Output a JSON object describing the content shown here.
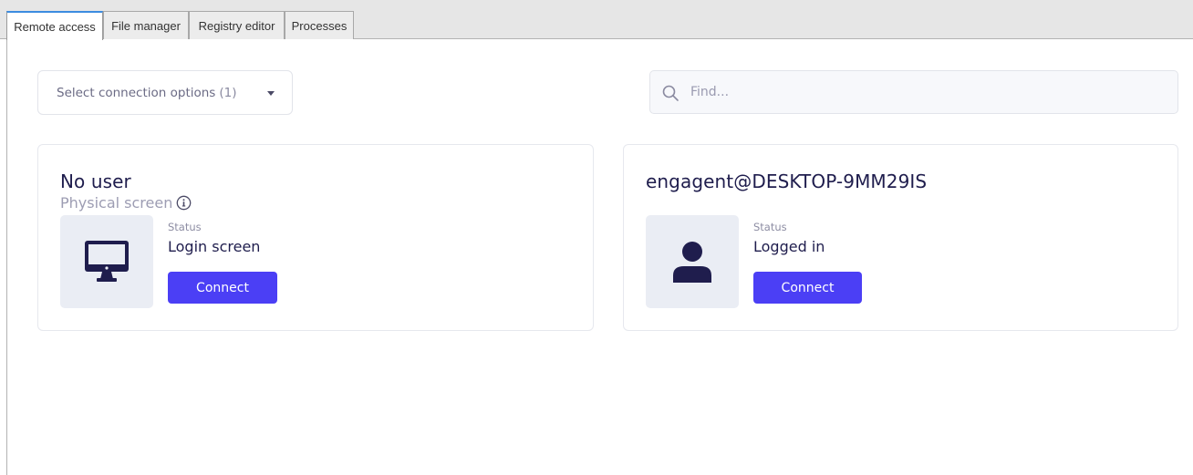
{
  "tabs": [
    {
      "label": "Remote access",
      "active": true
    },
    {
      "label": "File manager",
      "active": false
    },
    {
      "label": "Registry editor",
      "active": false
    },
    {
      "label": "Processes",
      "active": false
    }
  ],
  "toolbar": {
    "select_label": "Select connection options",
    "select_count": "(1)",
    "search_placeholder": "Find..."
  },
  "sessions": [
    {
      "title": "No user",
      "subtitle": "Physical screen",
      "icon": "monitor-icon",
      "status_label": "Status",
      "status_value": "Login screen",
      "button_label": "Connect"
    },
    {
      "title": "engagent@DESKTOP-9MM29IS",
      "icon": "user-icon",
      "status_label": "Status",
      "status_value": "Logged in",
      "button_label": "Connect"
    }
  ],
  "colors": {
    "accent": "#4b3ff5",
    "text_primary": "#1f1d4d",
    "text_muted": "#9d9db3",
    "icon_bg": "#eaedf4",
    "active_tab_border": "#3c8ce0"
  }
}
